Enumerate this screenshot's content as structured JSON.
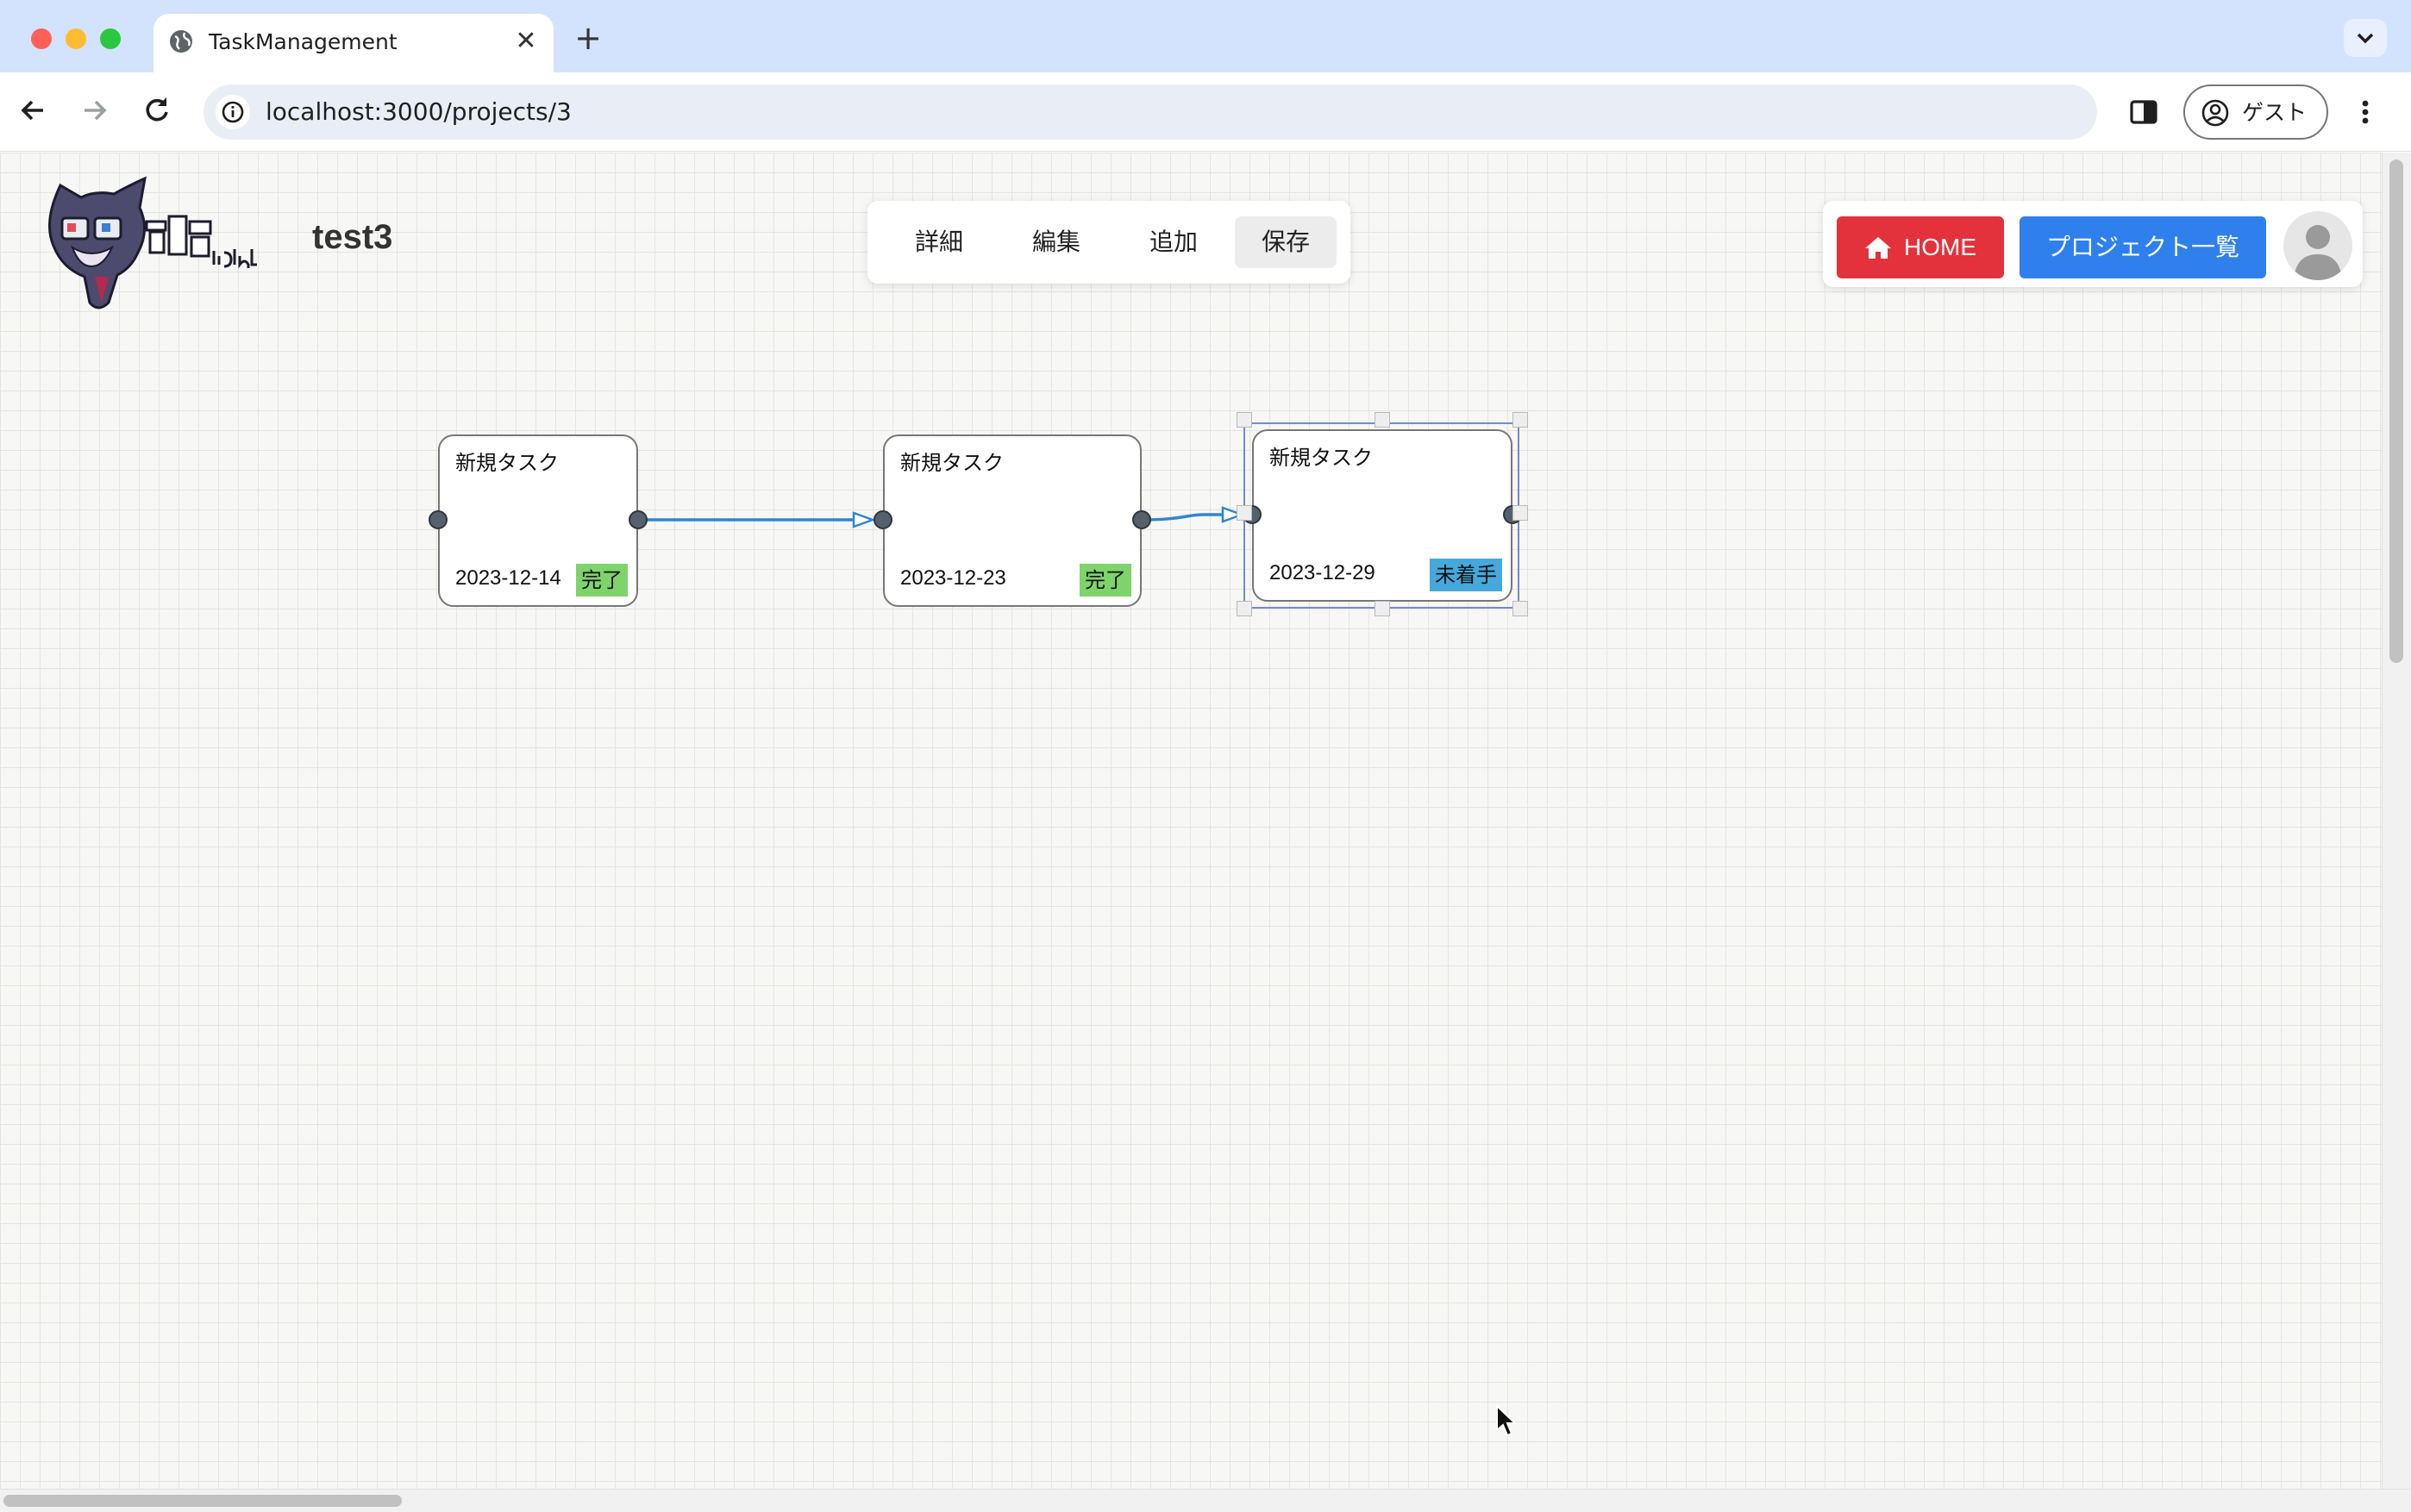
{
  "browser": {
    "tab_title": "TaskManagement",
    "url": "localhost:3000/projects/3",
    "profile_label": "ゲスト"
  },
  "app": {
    "logo_text": "監視君light",
    "project_title": "test3",
    "menu": [
      {
        "label": "詳細",
        "active": false
      },
      {
        "label": "編集",
        "active": false
      },
      {
        "label": "追加",
        "active": false
      },
      {
        "label": "保存",
        "active": true
      }
    ],
    "home_button": "HOME",
    "projects_button": "プロジェクト一覧"
  },
  "nodes": [
    {
      "title": "新規タスク",
      "date": "2023-12-14",
      "status": "完了",
      "status_color": "#7ed36a",
      "selected": false
    },
    {
      "title": "新規タスク",
      "date": "2023-12-23",
      "status": "完了",
      "status_color": "#7ed36a",
      "selected": false
    },
    {
      "title": "新規タスク",
      "date": "2023-12-29",
      "status": "未着手",
      "status_color": "#45a9dc",
      "selected": true
    }
  ],
  "colors": {
    "home_button": "#e3323b",
    "projects_button": "#2f80ed",
    "edge": "#2f86d1",
    "selection": "#6f8bd6"
  }
}
